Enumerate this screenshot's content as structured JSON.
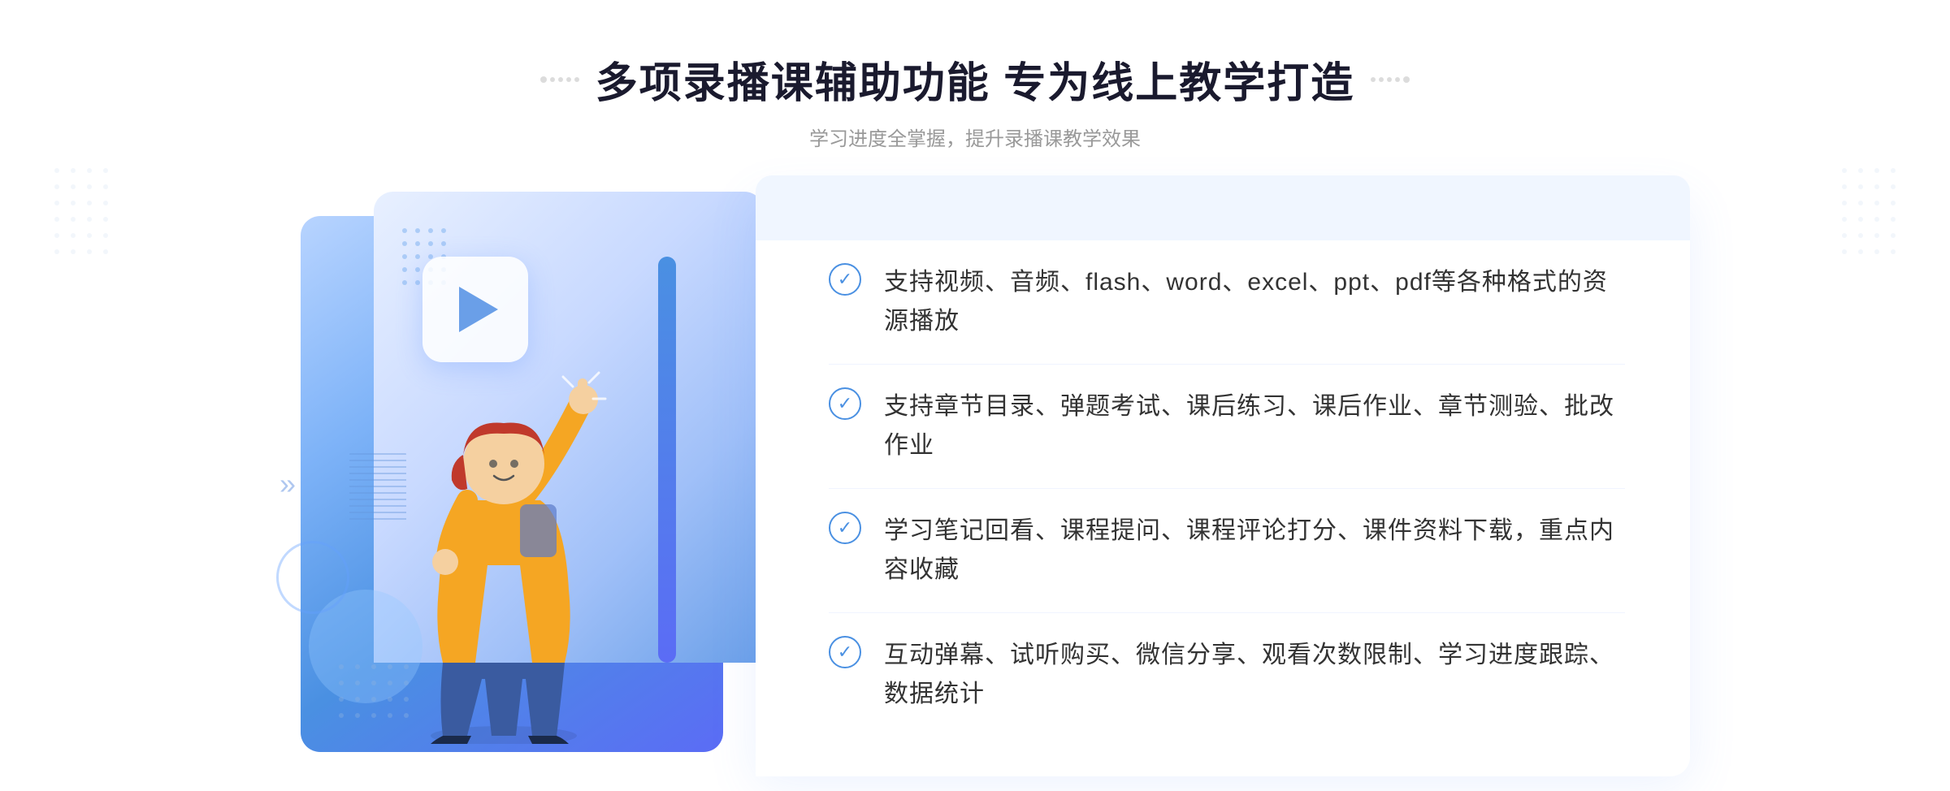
{
  "header": {
    "title": "多项录播课辅助功能 专为线上教学打造",
    "subtitle": "学习进度全掌握，提升录播课教学效果"
  },
  "features": [
    {
      "id": 1,
      "text": "支持视频、音频、flash、word、excel、ppt、pdf等各种格式的资源播放"
    },
    {
      "id": 2,
      "text": "支持章节目录、弹题考试、课后练习、课后作业、章节测验、批改作业"
    },
    {
      "id": 3,
      "text": "学习笔记回看、课程提问、课程评论打分、课件资料下载，重点内容收藏"
    },
    {
      "id": 4,
      "text": "互动弹幕、试听购买、微信分享、观看次数限制、学习进度跟踪、数据统计"
    }
  ],
  "decorations": {
    "left_arrow": "»",
    "check_symbol": "✓",
    "play_button_label": "play",
    "dots_count": 5
  },
  "colors": {
    "primary_blue": "#4a90e2",
    "accent_purple": "#5b6cf5",
    "light_blue": "#b8d4ff",
    "text_dark": "#1a1a2e",
    "text_gray": "#999999",
    "text_body": "#333333"
  }
}
